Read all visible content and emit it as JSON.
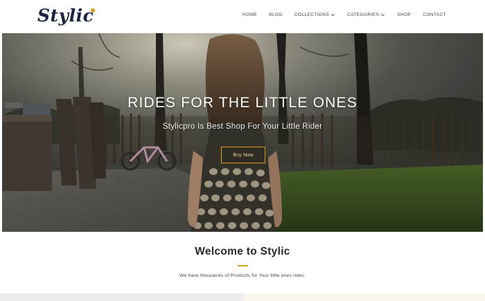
{
  "brand": {
    "name": "Stylic",
    "accent_color": "#d4a21c",
    "text_color": "#1b2340"
  },
  "nav": {
    "items": [
      {
        "label": "HOME",
        "dropdown": false
      },
      {
        "label": "BLOG",
        "dropdown": false
      },
      {
        "label": "COLLECTIONS",
        "dropdown": true
      },
      {
        "label": "CATEGORIES",
        "dropdown": true
      },
      {
        "label": "SHOP",
        "dropdown": false
      },
      {
        "label": "CONTACT",
        "dropdown": false
      }
    ]
  },
  "hero": {
    "title": "RIDES FOR THE LITTLE ONES",
    "subtitle": "Stylicpro Is Best Shop For Your Little Rider",
    "button_label": "Buy Now",
    "image": "girl-in-garden-photo"
  },
  "welcome": {
    "title": "Welcome to Stylic",
    "text": "We have thousands of Products for Your little ones rides."
  }
}
